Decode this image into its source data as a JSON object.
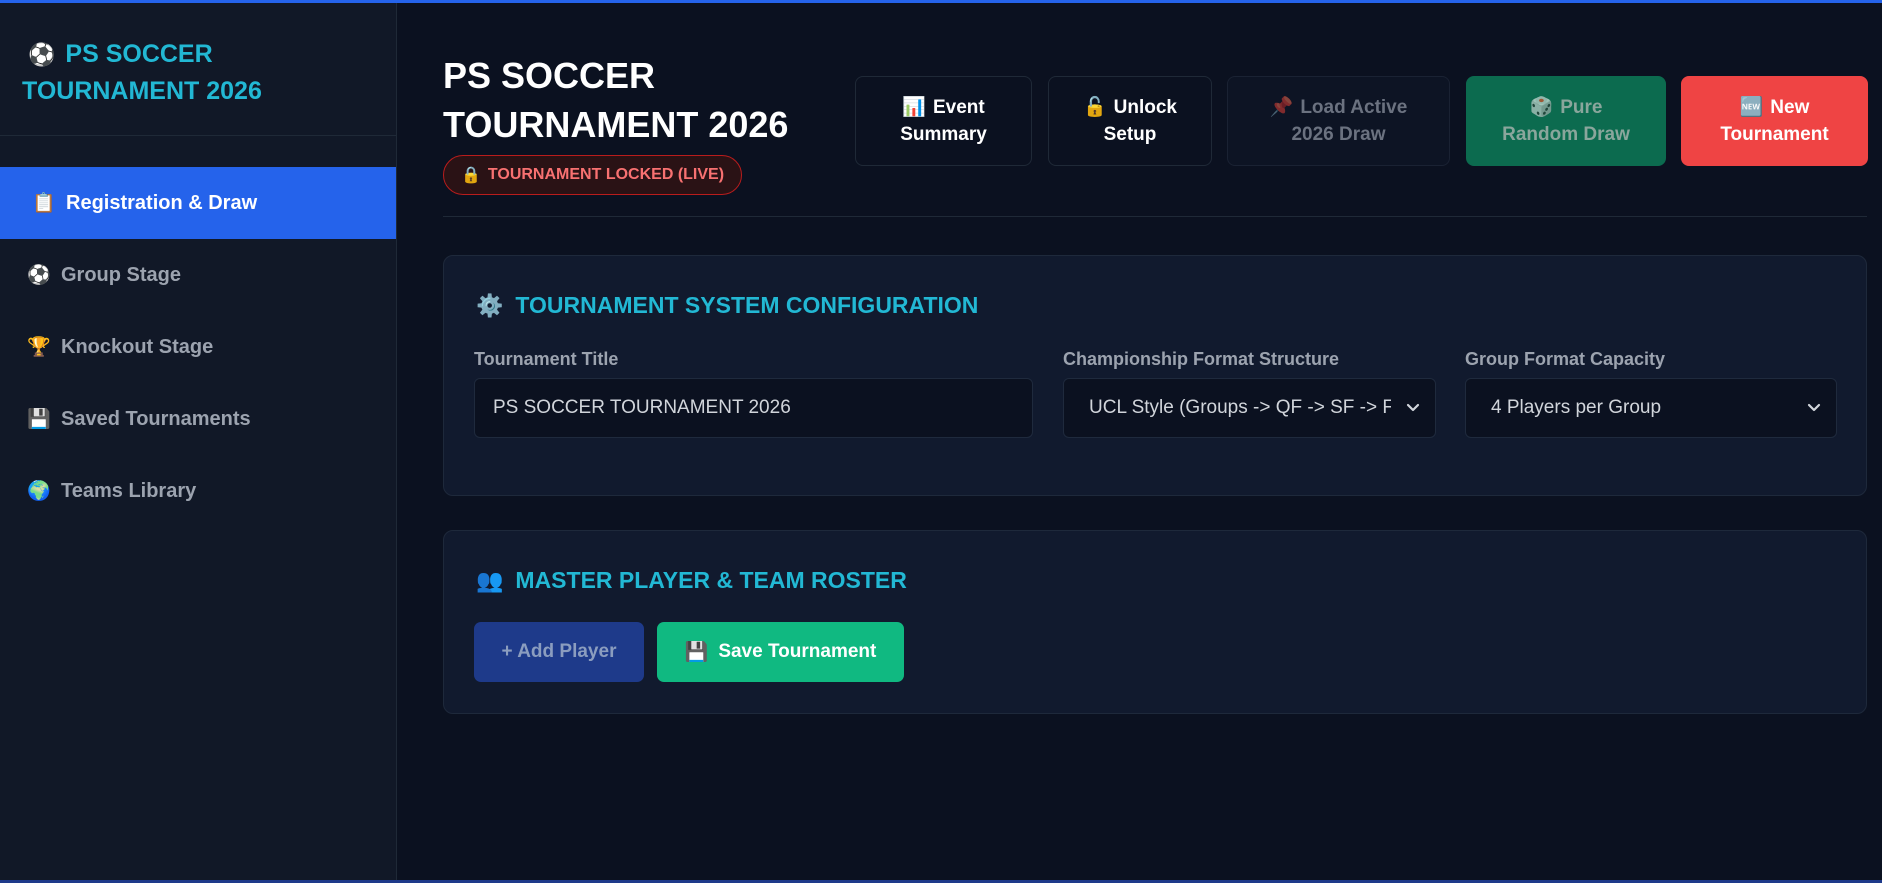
{
  "sidebar": {
    "brand_icon": "⚽",
    "brand_line1": "PS SOCCER",
    "brand_line2": "TOURNAMENT 2026",
    "items": [
      {
        "icon": "📋",
        "label": "Registration & Draw",
        "active": true
      },
      {
        "icon": "⚽",
        "label": "Group Stage",
        "active": false
      },
      {
        "icon": "🏆",
        "label": "Knockout Stage",
        "active": false
      },
      {
        "icon": "💾",
        "label": "Saved Tournaments",
        "active": false
      },
      {
        "icon": "🌍",
        "label": "Teams Library",
        "active": false
      }
    ]
  },
  "header": {
    "title_line1": "PS SOCCER",
    "title_line2": "TOURNAMENT 2026",
    "lock_badge_icon": "🔒",
    "lock_badge": "TOURNAMENT LOCKED (LIVE)",
    "buttons": {
      "event_summary": {
        "icon": "📊",
        "line1": "Event",
        "line2": "Summary"
      },
      "unlock_setup": {
        "icon": "🔓",
        "line1": "Unlock",
        "line2": "Setup"
      },
      "load_active": {
        "icon": "📌",
        "line1": "Load Active",
        "line2": "2026 Draw"
      },
      "random_draw": {
        "icon": "🎲",
        "line1": "Pure",
        "line2": "Random Draw"
      },
      "new_tournament": {
        "icon": "🆕",
        "line1": "New",
        "line2": "Tournament"
      }
    }
  },
  "config": {
    "icon": "⚙️",
    "title": "TOURNAMENT SYSTEM CONFIGURATION",
    "tournament_title_label": "Tournament Title",
    "tournament_title_value": "PS SOCCER TOURNAMENT 2026",
    "format_label": "Championship Format Structure",
    "format_value": "UCL Style (Groups -> QF -> SF -> Final)",
    "group_label": "Group Format Capacity",
    "group_value": "4 Players per Group"
  },
  "roster": {
    "icon": "👥",
    "title": "MASTER PLAYER & TEAM ROSTER",
    "add_player": "+ Add Player",
    "save_icon": "💾",
    "save_tournament": "Save Tournament"
  },
  "colors": {
    "accent": "#2563eb",
    "heading": "#22b8d4",
    "danger": "#ef4444",
    "success": "#10b981"
  }
}
